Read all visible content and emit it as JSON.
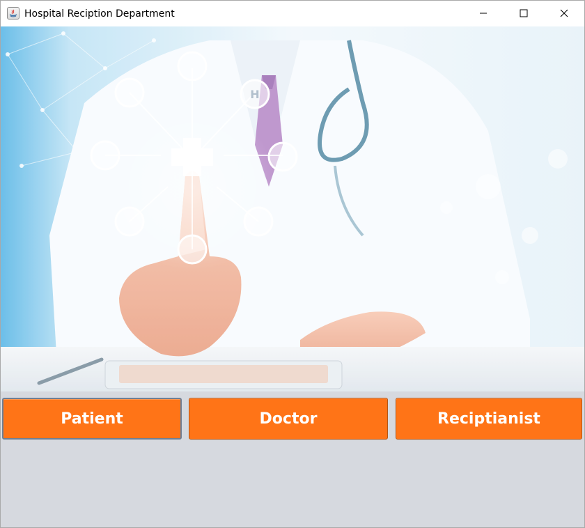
{
  "window": {
    "title": "Hospital Reciption Department",
    "controls": {
      "minimize": "minimize-icon",
      "maximize": "maximize-icon",
      "close": "close-icon"
    }
  },
  "banner": {
    "hex_icon_letter": "H"
  },
  "buttons": {
    "patient": "Patient",
    "doctor": "Doctor",
    "receptionist": "Reciptianist"
  },
  "colors": {
    "button_bg": "#ff7417",
    "panel_bg": "#d6d9df"
  }
}
